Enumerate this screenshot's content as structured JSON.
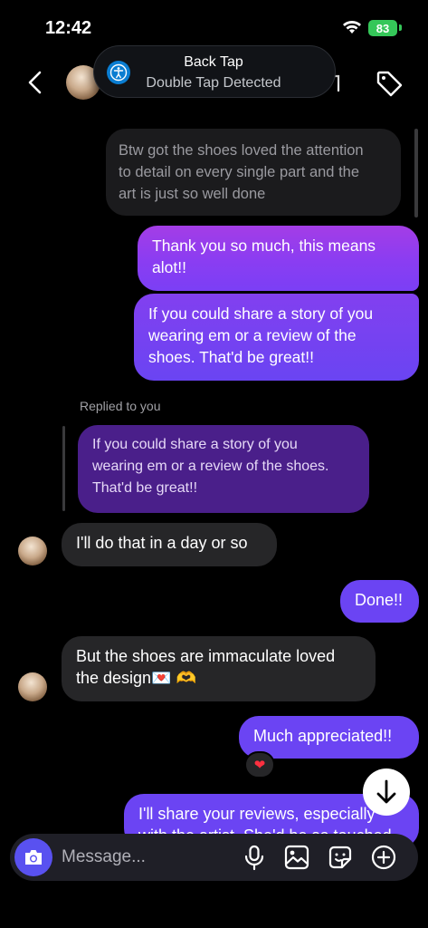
{
  "status_bar": {
    "time": "12:42",
    "battery": "83"
  },
  "toast": {
    "title": "Back Tap",
    "subtitle": "Double Tap Detected"
  },
  "messages": {
    "m1": [
      "Btw got the shoes loved the attention",
      "to detail on every single part and the",
      "art is just so well done"
    ],
    "m2": [
      "Thank you so much, this means",
      "alot!!"
    ],
    "m3": [
      "If you could share a story of you",
      "wearing em or a review of the",
      "shoes. That'd be great!!"
    ],
    "replied_label": "Replied to you",
    "m4_quote": [
      "If you could share a story of you",
      "wearing em or a review of the shoes.",
      "That'd be great!!"
    ],
    "m5": "I'll do that in a day or so",
    "m6": "Done!!",
    "m7": [
      "But the shoes are immaculate loved",
      "the design"
    ],
    "m7_emoji": "💌 🫶",
    "m8": "Much appreciated!!",
    "m8_reaction": "❤",
    "m9": [
      "I'll share your reviews, especially",
      "with the artist. She'd be so touched"
    ]
  },
  "composer": {
    "placeholder": "Message..."
  },
  "colors": {
    "accent": "#5951f0",
    "outgoing_top": "#a43de6",
    "outgoing_bottom": "#6b44f3",
    "incoming": "#262628"
  }
}
